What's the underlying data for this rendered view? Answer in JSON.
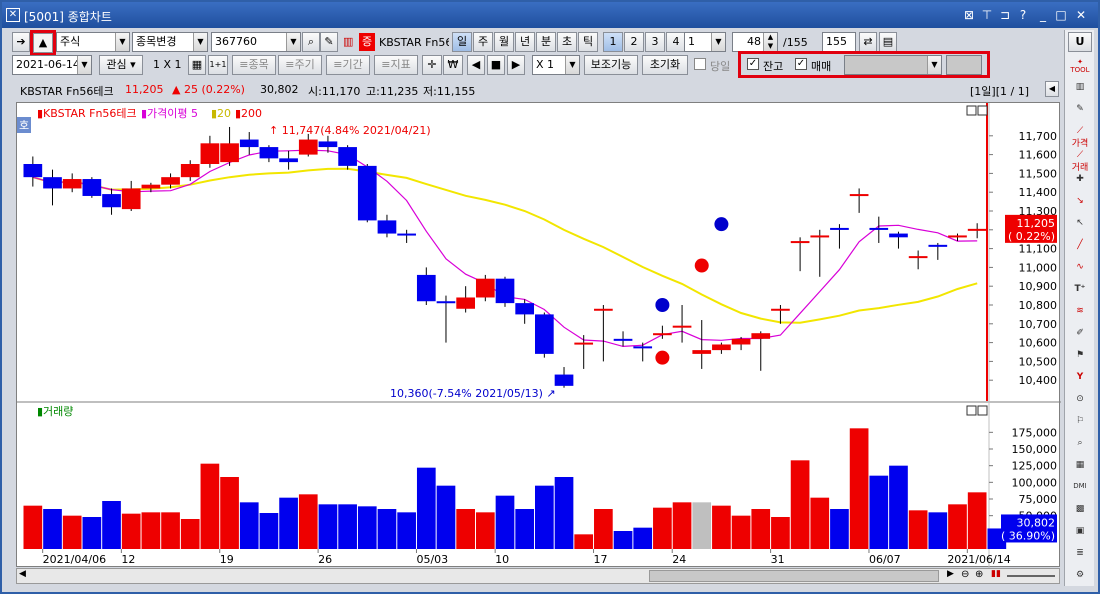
{
  "window": {
    "title": "[5001] 종합차트",
    "icons": [
      "close-box-icon",
      "pin-icon",
      "restore-icon",
      "help-icon",
      "minimize-icon",
      "maximize-icon",
      "close-icon"
    ]
  },
  "toolbar1": {
    "market": "주식",
    "change_btn": "종목변경",
    "code": "367760",
    "etf_badge": "증",
    "stock_name": "KBSTAR Fn56",
    "periods": [
      "일",
      "주",
      "월",
      "년",
      "분",
      "초",
      "틱"
    ],
    "active_period": "일",
    "nums": [
      "1",
      "2",
      "3",
      "4"
    ],
    "num_select": "1",
    "count": "48",
    "total": "/155",
    "count2": "155"
  },
  "toolbar2": {
    "date": "2021-06-14",
    "interest": "관심",
    "layout": "1 X 1",
    "grid_btn": "1+1",
    "btn_stock": "≡종목",
    "btn_period": "≡주기",
    "btn_period2": "≡기간",
    "btn_indicator": "≡지표",
    "zoom": "X 1",
    "assist": "보조기능",
    "reset": "초기화",
    "today_label": "당일",
    "chk_balance": "잔고",
    "chk_trade": "매매"
  },
  "infobar": {
    "name": "KBSTAR Fn56테크",
    "price": "11,205",
    "change": "▲ 25 (0.22%)",
    "volume": "30,802",
    "open": "시:11,170",
    "high": "고:11,235",
    "low": "저:11,155",
    "range": "[1일][1 / 1]"
  },
  "chart": {
    "legend_name": "KBSTAR Fn56테크",
    "legend_ma": "가격이평 5",
    "legend_20": "20",
    "legend_200": "200",
    "badge": "호",
    "high_note": "11,747(4.84% 2021/04/21)",
    "low_note": "10,360(-7.54% 2021/05/13)",
    "price_label": "11,205",
    "price_pct": "( 0.22%)",
    "vol_label": "30,802",
    "vol_pct": "( 36.90%)",
    "vol_title": "거래량",
    "y_ticks": [
      "11,700",
      "11,600",
      "11,500",
      "11,400",
      "11,300",
      "11,200",
      "11,100",
      "11,000",
      "10,900",
      "10,800",
      "10,700",
      "10,600",
      "10,500",
      "10,400"
    ],
    "vol_ticks": [
      "175,000",
      "150,000",
      "125,000",
      "100,000",
      "75,000",
      "50,000",
      "25,000"
    ],
    "x_labels": [
      "2021/04/06",
      "12",
      "19",
      "26",
      "05/03",
      "10",
      "17",
      "24",
      "31",
      "06/07",
      "2021/06/14"
    ],
    "up_color": "#ee0000",
    "down_color": "#0000ee",
    "ma5_color": "#d800d8",
    "ma20_color": "#f2e600"
  },
  "chart_data": {
    "type": "candlestick",
    "dates": [
      "04/05",
      "04/06",
      "04/07",
      "04/08",
      "04/09",
      "04/12",
      "04/13",
      "04/14",
      "04/15",
      "04/16",
      "04/19",
      "04/20",
      "04/21",
      "04/22",
      "04/23",
      "04/26",
      "04/27",
      "04/28",
      "04/29",
      "04/30",
      "05/03",
      "05/04",
      "05/06",
      "05/07",
      "05/10",
      "05/11",
      "05/12",
      "05/13",
      "05/14",
      "05/17",
      "05/18",
      "05/20",
      "05/21",
      "05/24",
      "05/25",
      "05/26",
      "05/27",
      "05/28",
      "05/31",
      "06/01",
      "06/02",
      "06/03",
      "06/04",
      "06/07",
      "06/08",
      "06/09",
      "06/10",
      "06/11",
      "06/14"
    ],
    "open": [
      11550,
      11480,
      11420,
      11470,
      11390,
      11310,
      11420,
      11440,
      11480,
      11550,
      11560,
      11680,
      11640,
      11580,
      11600,
      11670,
      11640,
      11540,
      11250,
      11180,
      10960,
      10820,
      10780,
      10840,
      10940,
      10810,
      10750,
      10430,
      10600,
      10780,
      10620,
      10580,
      10650,
      10690,
      10540,
      10560,
      10590,
      10620,
      10780,
      11140,
      11170,
      11210,
      11390,
      11210,
      11180,
      11060,
      11120,
      11170,
      11200
    ],
    "close": [
      11480,
      11420,
      11470,
      11380,
      11320,
      11420,
      11440,
      11480,
      11550,
      11660,
      11660,
      11640,
      11580,
      11560,
      11680,
      11640,
      11540,
      11250,
      11180,
      11170,
      10820,
      10810,
      10840,
      10940,
      10810,
      10750,
      10540,
      10370,
      10600,
      10780,
      10610,
      10570,
      10650,
      10690,
      10560,
      10590,
      10620,
      10650,
      10780,
      11140,
      11170,
      11200,
      11390,
      11200,
      11160,
      11060,
      11110,
      11170,
      11205
    ],
    "high": [
      11590,
      11520,
      11500,
      11480,
      11420,
      11460,
      11450,
      11500,
      11570,
      11700,
      11747,
      11720,
      11650,
      11620,
      11710,
      11700,
      11650,
      11550,
      11280,
      11200,
      11000,
      10850,
      10900,
      10960,
      10950,
      10830,
      10760,
      10470,
      10640,
      10800,
      10660,
      10600,
      10690,
      10800,
      10720,
      10600,
      10630,
      10660,
      10800,
      11160,
      11200,
      11230,
      11420,
      11270,
      11190,
      11090,
      11130,
      11180,
      11235
    ],
    "low": [
      11430,
      11330,
      11400,
      11370,
      11280,
      11300,
      11400,
      11420,
      11460,
      11530,
      11540,
      11600,
      11560,
      11520,
      11590,
      11610,
      11520,
      11240,
      11160,
      11130,
      10800,
      10600,
      10760,
      10820,
      10790,
      10700,
      10520,
      10360,
      10460,
      10500,
      10580,
      10500,
      10620,
      10600,
      10460,
      10540,
      10560,
      10450,
      10700,
      10980,
      10950,
      11100,
      11290,
      11130,
      11100,
      10990,
      11040,
      11140,
      11155
    ],
    "volume": [
      65000,
      60000,
      50000,
      48000,
      72000,
      53000,
      55000,
      55000,
      45000,
      128000,
      108000,
      70000,
      54000,
      77000,
      82000,
      67000,
      67000,
      64000,
      60000,
      55000,
      122000,
      95000,
      60000,
      55000,
      80000,
      60000,
      95000,
      108000,
      22000,
      60000,
      27000,
      32000,
      62000,
      70000,
      70000,
      65000,
      50000,
      60000,
      48000,
      133000,
      77000,
      60000,
      181000,
      110000,
      125000,
      58000,
      55000,
      67000,
      85000,
      30802
    ],
    "y_range": [
      10300,
      11800
    ],
    "vol_range": [
      0,
      195000
    ]
  }
}
